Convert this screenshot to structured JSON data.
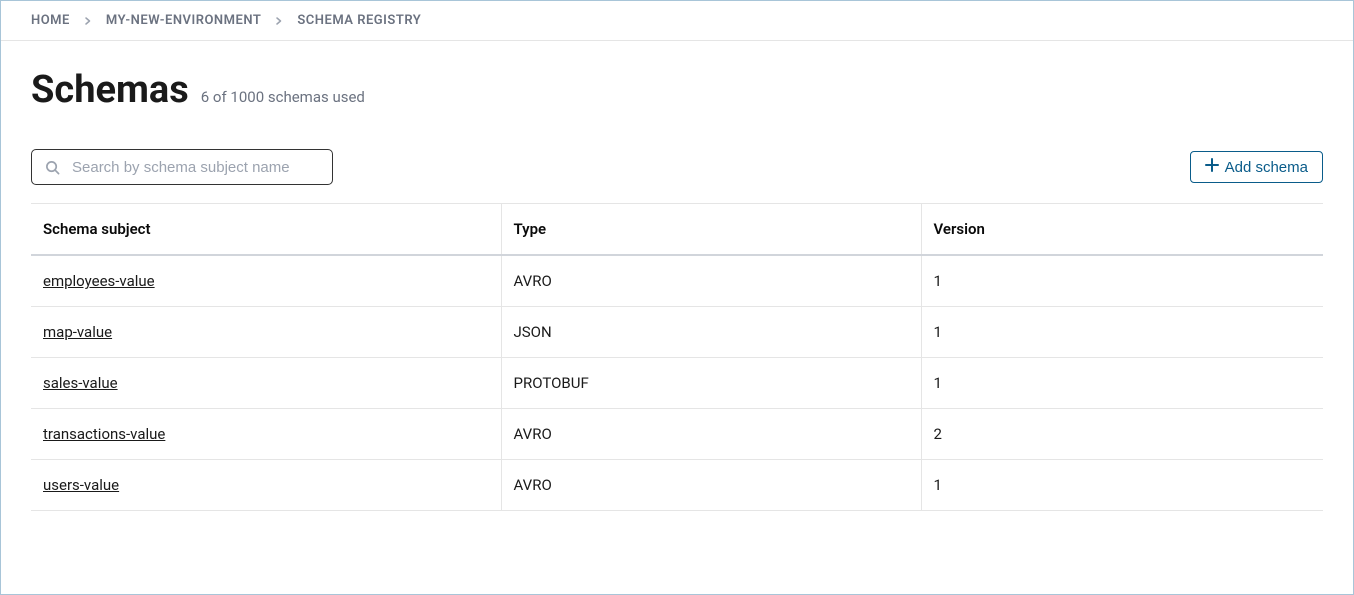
{
  "breadcrumb": {
    "items": [
      {
        "label": "HOME"
      },
      {
        "label": "MY-NEW-ENVIRONMENT"
      },
      {
        "label": "SCHEMA REGISTRY"
      }
    ]
  },
  "header": {
    "title": "Schemas",
    "subtitle": "6 of 1000 schemas used"
  },
  "toolbar": {
    "search_placeholder": "Search by schema subject name",
    "add_label": "Add schema"
  },
  "table": {
    "columns": {
      "subject": "Schema subject",
      "type": "Type",
      "version": "Version"
    },
    "rows": [
      {
        "subject": "employees-value",
        "type": "AVRO",
        "version": "1"
      },
      {
        "subject": "map-value",
        "type": "JSON",
        "version": "1"
      },
      {
        "subject": "sales-value",
        "type": "PROTOBUF",
        "version": "1"
      },
      {
        "subject": "transactions-value",
        "type": "AVRO",
        "version": "2"
      },
      {
        "subject": "users-value",
        "type": "AVRO",
        "version": "1"
      }
    ]
  }
}
